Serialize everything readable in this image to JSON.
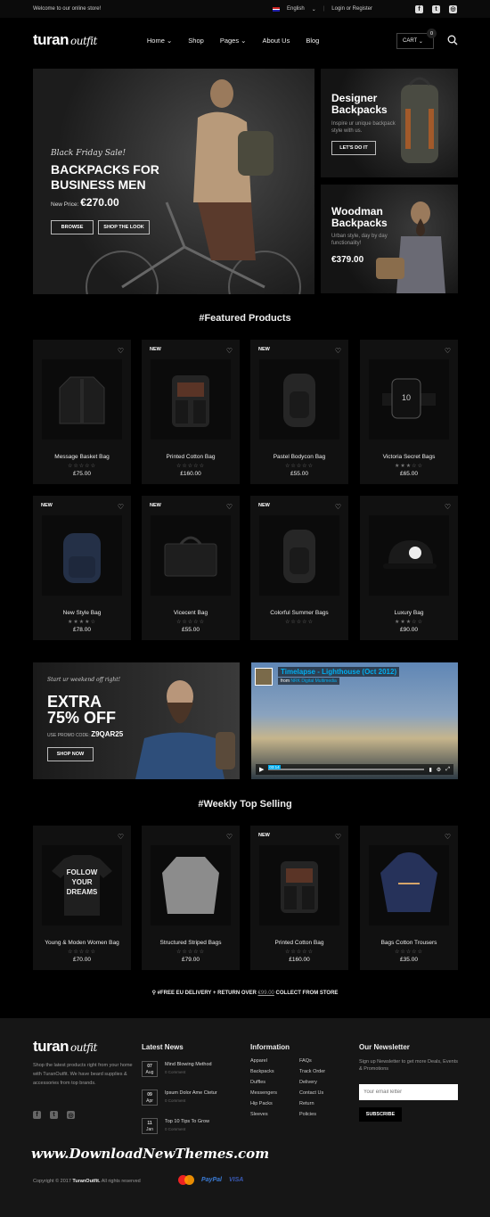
{
  "topbar": {
    "welcome": "Welcome to our online store!",
    "language": "English",
    "login": "Login or Register",
    "social": [
      "facebook-icon",
      "twitter-icon",
      "instagram-icon"
    ]
  },
  "header": {
    "logo_main": "turan",
    "logo_script": "outfit",
    "nav": [
      "Home",
      "Shop",
      "Pages",
      "About Us",
      "Blog"
    ],
    "cart_label": "CART",
    "cart_count": "0"
  },
  "hero": {
    "tagline": "Black Friday Sale!",
    "title": "BACKPACKS FOR BUSINESS MEN",
    "price_label": "New Price:",
    "price": "€270.00",
    "browse": "BROWSE",
    "shop_look": "SHOP THE LOOK"
  },
  "side1": {
    "title": "Designer Backpacks",
    "desc": "Inspire ur unique backpack style with us.",
    "button": "LET'S DO IT"
  },
  "side2": {
    "title": "Woodman Backpacks",
    "desc": "Urban style, day by day functionality!",
    "price": "€379.00"
  },
  "featured": {
    "title": "#Featured Products",
    "products": [
      {
        "name": "Message Basket Bag",
        "price": "£75.00",
        "isnew": "",
        "kind": "jacket",
        "rating": 0
      },
      {
        "name": "Printed Cotton Bag",
        "price": "£160.00",
        "isnew": "NEW",
        "kind": "backpack",
        "rating": 0
      },
      {
        "name": "Pastel Bodycon Bag",
        "price": "£55.00",
        "isnew": "NEW",
        "kind": "backpack2",
        "rating": 0
      },
      {
        "name": "Victoria Secret Bags",
        "price": "£65.00",
        "isnew": "",
        "kind": "watch",
        "rating": 3
      },
      {
        "name": "New Style Bag",
        "price": "£78.00",
        "isnew": "NEW",
        "kind": "bluebag",
        "rating": 4
      },
      {
        "name": "Vicecent Bag",
        "price": "£55.00",
        "isnew": "NEW",
        "kind": "briefcase",
        "rating": 0
      },
      {
        "name": "Colorful Summer Bags",
        "price": "",
        "isnew": "NEW",
        "kind": "backpack2",
        "rating": 0
      },
      {
        "name": "Luxury Bag",
        "price": "£90.00",
        "isnew": "",
        "kind": "cap",
        "rating": 3
      }
    ]
  },
  "promo": {
    "tagline": "Start ur weekend off right!",
    "line1": "EXTRA",
    "line2": "75% OFF",
    "code_label": "USE PROMO CODE:",
    "code": "Z9QAR25",
    "button": "SHOP NOW"
  },
  "video": {
    "title": "Timelapse - Lighthouse (Oct 2012)",
    "from": "from",
    "author": "NRK Digital Multimedia",
    "time": "03:14"
  },
  "weekly": {
    "title": "#Weekly Top Selling",
    "products": [
      {
        "name": "Young & Moden Women Bag",
        "price": "£70.00",
        "isnew": "",
        "kind": "tshirt",
        "rating": 0,
        "tee_text": "FOLLOW YOUR DREAMS"
      },
      {
        "name": "Structured Striped Bags",
        "price": "£79.00",
        "isnew": "",
        "kind": "sweater",
        "rating": 0
      },
      {
        "name": "Printed Cotton Bag",
        "price": "£160.00",
        "isnew": "NEW",
        "kind": "backpack",
        "rating": 0
      },
      {
        "name": "Bags Cotton Trousers",
        "price": "£35.00",
        "isnew": "",
        "kind": "hoodie",
        "rating": 0
      }
    ]
  },
  "delivery": {
    "text": "#FREE EU DELIVERY + RETURN OVER",
    "amount": "€99.00",
    "suffix": "COLLECT FROM STORE"
  },
  "footer": {
    "about": "Shop the latest products right from your home with TuranOutfit. We have beard supplies & accessories from top brands.",
    "news_title": "Latest News",
    "news": [
      {
        "day": "07",
        "month": "Aug",
        "title": "Mind Blowing Method",
        "comments": "0 Comment"
      },
      {
        "day": "09",
        "month": "Apr",
        "title": "Ipsum Dolor Ame Ctetur",
        "comments": "0 Comment"
      },
      {
        "day": "11",
        "month": "Jan",
        "title": "Top 10 Tips To Grow",
        "comments": "0 Comment"
      }
    ],
    "info_title": "Information",
    "info_col1": [
      "Apparel",
      "Backpacks",
      "Duffles",
      "Messengers",
      "Hip Packs",
      "Sleeves"
    ],
    "info_col2": [
      "FAQs",
      "Track Order",
      "Delivery",
      "Contact Us",
      "Return",
      "Policies"
    ],
    "newsletter_title": "Our Newsletter",
    "newsletter_desc": "Sign up Newsletter to get more Deals, Events & Promotions",
    "email_placeholder": "Your email letter",
    "subscribe": "SUBSCRIBE",
    "watermark": "www.DownloadNewThemes.com",
    "copyright_pre": "Copyright © 2017",
    "copyright_brand": "TuranOutfit.",
    "copyright_post": "All rights reserved",
    "payments": [
      "mastercard-icon",
      "PayPal",
      "VISA"
    ]
  }
}
